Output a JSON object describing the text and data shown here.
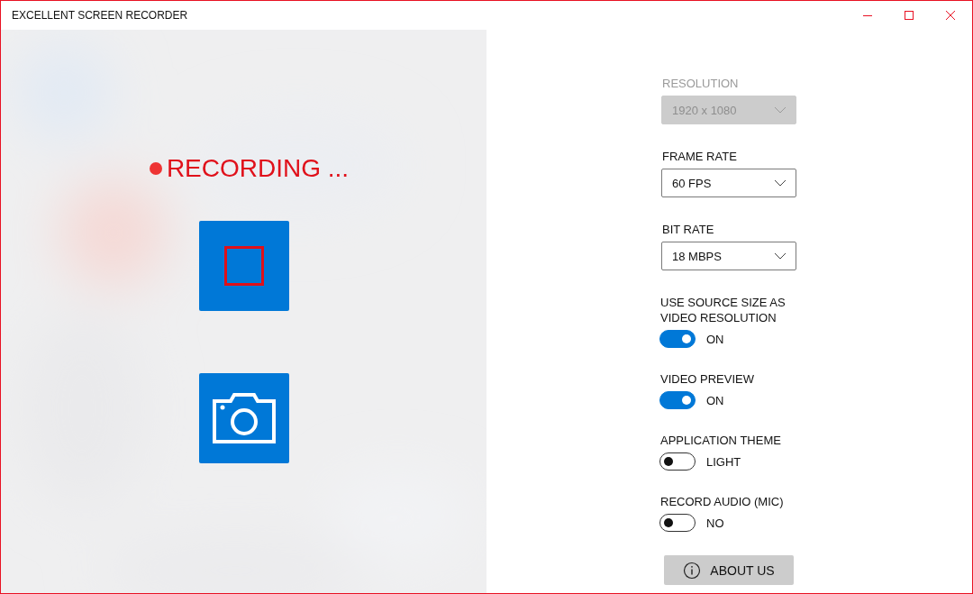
{
  "window": {
    "title": "EXCELLENT SCREEN RECORDER"
  },
  "preview": {
    "kind": "picture",
    "recording": true,
    "status": "RECORDING ..."
  },
  "settings": [
    {
      "kind": "dropdown",
      "label": "RESOLUTION",
      "value": "1920 x 1080",
      "disabled": true
    },
    {
      "kind": "dropdown",
      "label": "FRAME RATE",
      "value": "60 FPS",
      "disabled": false
    },
    {
      "kind": "dropdown",
      "label": "BIT RATE",
      "value": "18 MBPS",
      "disabled": false
    },
    {
      "kind": "toggle",
      "label": "USE SOURCE SIZE AS VIDEO RESOLUTION",
      "on": true,
      "state_label": "ON"
    },
    {
      "kind": "toggle",
      "label": "VIDEO PREVIEW",
      "on": true,
      "state_label": "ON"
    },
    {
      "kind": "toggle",
      "label": "APPLICATION THEME",
      "on": false,
      "state_label": "LIGHT"
    },
    {
      "kind": "toggle",
      "label": "RECORD AUDIO (MIC)",
      "on": false,
      "state_label": "NO"
    }
  ],
  "about_button": "ABOUT US"
}
